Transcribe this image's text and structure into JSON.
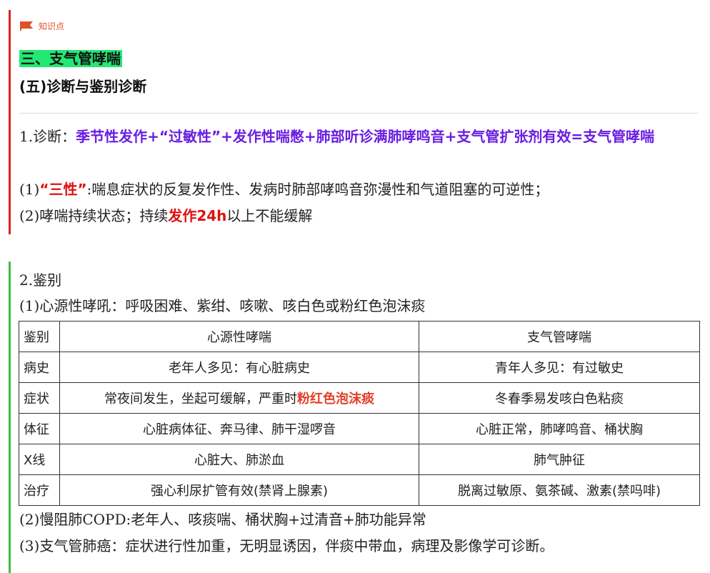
{
  "tag": {
    "label": "知识点",
    "icon": "flag-icon",
    "color": "#e0502a"
  },
  "section": {
    "title": "三、支气管哮喘",
    "subtitle": "(五)诊断与鉴别诊断"
  },
  "diagnosis": {
    "lead": "1.诊断：",
    "formula": "季节性发作+“过敏性”+发作性喘憋+肺部听诊满肺哮鸣音+支气管扩张剂有效=支气管哮喘",
    "item1_prefix": "(1)",
    "item1_key": "“三性”",
    "item1_text": ":喘息症状的反复发作性、发病时肺部哮鸣音弥漫性和气道阻塞的可逆性；",
    "item2_prefix": "(2)哮喘持续状态；持续",
    "item2_key": "发作24h",
    "item2_text": "以上不能缓解"
  },
  "differential": {
    "title": "2.鉴别",
    "item1": "(1)心源性哮吼：呼吸困难、紫绀、咳嗽、咳白色或粉红色泡沫痰",
    "table": {
      "headers": [
        "鉴别",
        "心源性哮喘",
        "支气管哮喘"
      ],
      "rows": [
        {
          "label": "病史",
          "a": "老年人多见：有心脏病史",
          "b": "青年人多见：有过敏史"
        },
        {
          "label": "症状",
          "a_prefix": "常夜间发生，坐起可缓解，严重时",
          "a_key": "粉红色泡沫痰",
          "b": "冬春季易发咳白色粘痰"
        },
        {
          "label": "体征",
          "a": "心脏病体征、奔马律、肺干湿啰音",
          "b": "心脏正常，肺哮鸣音、桶状胸"
        },
        {
          "label": "X线",
          "a": "心脏大、肺淤血",
          "b": "肺气肿征"
        },
        {
          "label": "治疗",
          "a": "强心利尿扩管有效(禁肾上腺素)",
          "b": "脱离过敏原、氨茶碱、激素(禁吗啡)"
        }
      ]
    },
    "item2": "(2)慢阻肺COPD:老年人、咳痰喘、桶状胸+过清音+肺功能异常",
    "item3": "(3)支气管肺癌：症状进行性加重，无明显诱因，伴痰中带血，病理及影像学可诊断。"
  },
  "colors": {
    "highlight": "#22e874",
    "purple": "#6a1ee0",
    "red": "#e01010",
    "bar_red": "#e02020",
    "bar_green": "#3fbf3f"
  }
}
